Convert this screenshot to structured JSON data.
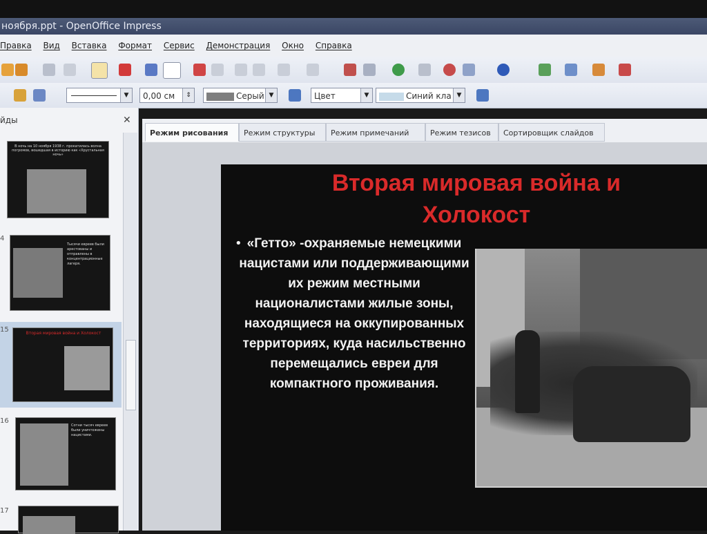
{
  "window": {
    "title": "ноября.ppt - OpenOffice Impress"
  },
  "menu": [
    "Правка",
    "Вид",
    "Вставка",
    "Формат",
    "Сервис",
    "Демонстрация",
    "Окно",
    "Справка"
  ],
  "format_bar": {
    "line_width": "0,00 см",
    "line_color": "Серый",
    "fill_type": "Цвет",
    "fill_color": "Синий кла"
  },
  "slides_panel": {
    "title": "йды",
    "slide_numbers": [
      "4",
      "15",
      "16",
      "17"
    ],
    "thumb1_text": "В ночь на 10 ноября 1938 г. прокатилась волна погромов, вошедшая в историю как «Хрустальная ночь»",
    "thumb2_text": "Тысячи евреев были арестованы и отправлены в концентрационные лагеря.",
    "thumb3_title": "Вторая мировая война и Холокост",
    "thumb4_text": "Сотни тысяч евреев были уничтожены нацистами."
  },
  "tabs": [
    "Режим рисования",
    "Режим структуры",
    "Режим примечаний",
    "Режим тезисов",
    "Сортировщик слайдов"
  ],
  "slide": {
    "title": "Вторая мировая война и Холокост",
    "bullet": "«Гетто» -охраняемые немецкими нацистами или поддерживающими их режим местными националистами жилые зоны, находящиеся на оккупированных территориях, куда насильственно перемещались евреи для компактного проживания."
  },
  "colors": {
    "title_red": "#d92a2a",
    "slide_bg": "#0d0d0d",
    "titlebar": "#3a4664"
  }
}
